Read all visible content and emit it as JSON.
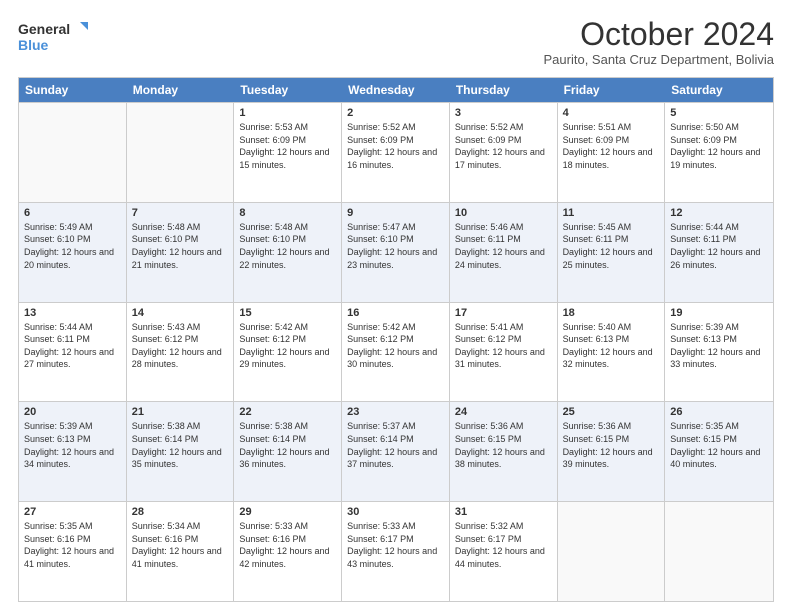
{
  "logo": {
    "line1": "General",
    "line2": "Blue"
  },
  "title": "October 2024",
  "location": "Paurito, Santa Cruz Department, Bolivia",
  "days_of_week": [
    "Sunday",
    "Monday",
    "Tuesday",
    "Wednesday",
    "Thursday",
    "Friday",
    "Saturday"
  ],
  "weeks": [
    [
      {
        "day": "",
        "empty": true
      },
      {
        "day": "",
        "empty": true
      },
      {
        "day": "1",
        "sunrise": "5:53 AM",
        "sunset": "6:09 PM",
        "daylight": "12 hours and 15 minutes."
      },
      {
        "day": "2",
        "sunrise": "5:52 AM",
        "sunset": "6:09 PM",
        "daylight": "12 hours and 16 minutes."
      },
      {
        "day": "3",
        "sunrise": "5:52 AM",
        "sunset": "6:09 PM",
        "daylight": "12 hours and 17 minutes."
      },
      {
        "day": "4",
        "sunrise": "5:51 AM",
        "sunset": "6:09 PM",
        "daylight": "12 hours and 18 minutes."
      },
      {
        "day": "5",
        "sunrise": "5:50 AM",
        "sunset": "6:09 PM",
        "daylight": "12 hours and 19 minutes."
      }
    ],
    [
      {
        "day": "6",
        "sunrise": "5:49 AM",
        "sunset": "6:10 PM",
        "daylight": "12 hours and 20 minutes."
      },
      {
        "day": "7",
        "sunrise": "5:48 AM",
        "sunset": "6:10 PM",
        "daylight": "12 hours and 21 minutes."
      },
      {
        "day": "8",
        "sunrise": "5:48 AM",
        "sunset": "6:10 PM",
        "daylight": "12 hours and 22 minutes."
      },
      {
        "day": "9",
        "sunrise": "5:47 AM",
        "sunset": "6:10 PM",
        "daylight": "12 hours and 23 minutes."
      },
      {
        "day": "10",
        "sunrise": "5:46 AM",
        "sunset": "6:11 PM",
        "daylight": "12 hours and 24 minutes."
      },
      {
        "day": "11",
        "sunrise": "5:45 AM",
        "sunset": "6:11 PM",
        "daylight": "12 hours and 25 minutes."
      },
      {
        "day": "12",
        "sunrise": "5:44 AM",
        "sunset": "6:11 PM",
        "daylight": "12 hours and 26 minutes."
      }
    ],
    [
      {
        "day": "13",
        "sunrise": "5:44 AM",
        "sunset": "6:11 PM",
        "daylight": "12 hours and 27 minutes."
      },
      {
        "day": "14",
        "sunrise": "5:43 AM",
        "sunset": "6:12 PM",
        "daylight": "12 hours and 28 minutes."
      },
      {
        "day": "15",
        "sunrise": "5:42 AM",
        "sunset": "6:12 PM",
        "daylight": "12 hours and 29 minutes."
      },
      {
        "day": "16",
        "sunrise": "5:42 AM",
        "sunset": "6:12 PM",
        "daylight": "12 hours and 30 minutes."
      },
      {
        "day": "17",
        "sunrise": "5:41 AM",
        "sunset": "6:12 PM",
        "daylight": "12 hours and 31 minutes."
      },
      {
        "day": "18",
        "sunrise": "5:40 AM",
        "sunset": "6:13 PM",
        "daylight": "12 hours and 32 minutes."
      },
      {
        "day": "19",
        "sunrise": "5:39 AM",
        "sunset": "6:13 PM",
        "daylight": "12 hours and 33 minutes."
      }
    ],
    [
      {
        "day": "20",
        "sunrise": "5:39 AM",
        "sunset": "6:13 PM",
        "daylight": "12 hours and 34 minutes."
      },
      {
        "day": "21",
        "sunrise": "5:38 AM",
        "sunset": "6:14 PM",
        "daylight": "12 hours and 35 minutes."
      },
      {
        "day": "22",
        "sunrise": "5:38 AM",
        "sunset": "6:14 PM",
        "daylight": "12 hours and 36 minutes."
      },
      {
        "day": "23",
        "sunrise": "5:37 AM",
        "sunset": "6:14 PM",
        "daylight": "12 hours and 37 minutes."
      },
      {
        "day": "24",
        "sunrise": "5:36 AM",
        "sunset": "6:15 PM",
        "daylight": "12 hours and 38 minutes."
      },
      {
        "day": "25",
        "sunrise": "5:36 AM",
        "sunset": "6:15 PM",
        "daylight": "12 hours and 39 minutes."
      },
      {
        "day": "26",
        "sunrise": "5:35 AM",
        "sunset": "6:15 PM",
        "daylight": "12 hours and 40 minutes."
      }
    ],
    [
      {
        "day": "27",
        "sunrise": "5:35 AM",
        "sunset": "6:16 PM",
        "daylight": "12 hours and 41 minutes."
      },
      {
        "day": "28",
        "sunrise": "5:34 AM",
        "sunset": "6:16 PM",
        "daylight": "12 hours and 41 minutes."
      },
      {
        "day": "29",
        "sunrise": "5:33 AM",
        "sunset": "6:16 PM",
        "daylight": "12 hours and 42 minutes."
      },
      {
        "day": "30",
        "sunrise": "5:33 AM",
        "sunset": "6:17 PM",
        "daylight": "12 hours and 43 minutes."
      },
      {
        "day": "31",
        "sunrise": "5:32 AM",
        "sunset": "6:17 PM",
        "daylight": "12 hours and 44 minutes."
      },
      {
        "day": "",
        "empty": true
      },
      {
        "day": "",
        "empty": true
      }
    ]
  ],
  "labels": {
    "sunrise_prefix": "Sunrise: ",
    "sunset_prefix": "Sunset: ",
    "daylight_prefix": "Daylight: "
  }
}
